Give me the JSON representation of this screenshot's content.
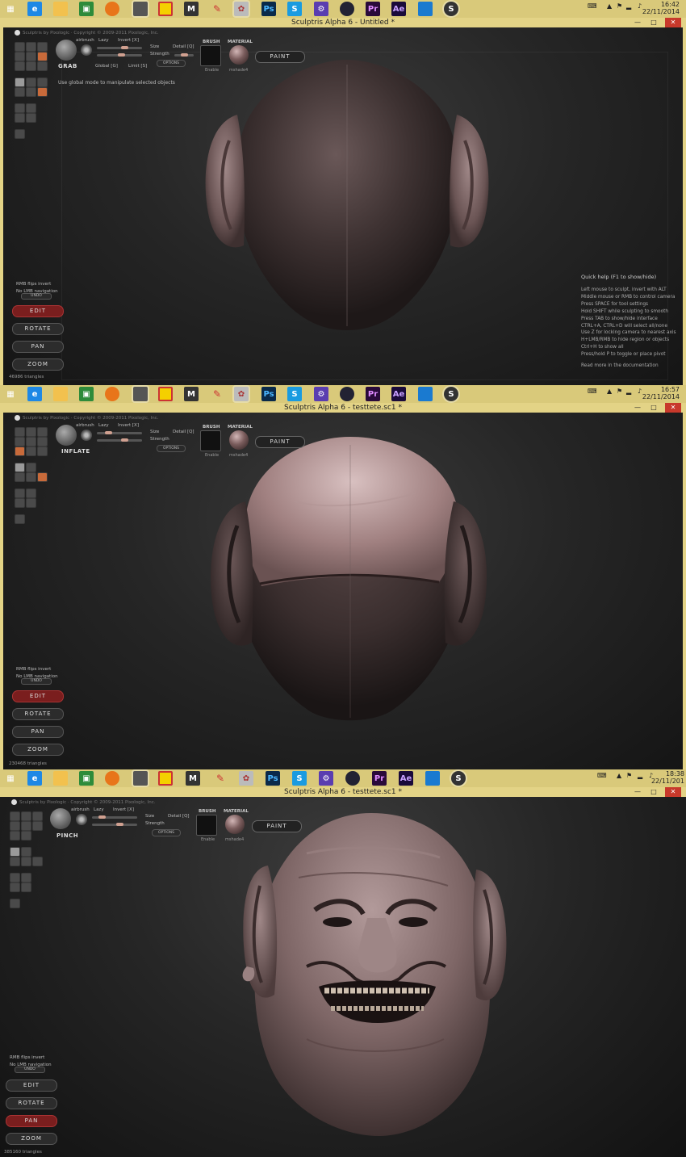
{
  "taskbar_icons": [
    "windows-start-icon",
    "ie-icon",
    "explorer-icon",
    "store-icon",
    "firefox-icon",
    "app-icon",
    "sticky-icon",
    "m-icon",
    "pencil-icon",
    "sculptris-doll-icon",
    "photoshop-icon",
    "skype-icon",
    "gear-icon",
    "camera-icon",
    "premiere-icon",
    "aftereffects-icon",
    "mail-icon",
    "sculptris-icon"
  ],
  "icon_labels": {
    "ps": "Ps",
    "pr": "Pr",
    "ae": "Ae",
    "m": "M",
    "s": "S"
  },
  "copyright": "Sculptris by Pixologic · Copyright © 2009-2011 Pixologic, Inc.",
  "labels": {
    "airbrush": "airbrush",
    "lazy": "Lazy",
    "invert": "Invert [X]",
    "size": "Size",
    "strength": "Strength",
    "detail": "Detail [Q]",
    "global": "Global [G]",
    "limit": "Limit [S]",
    "options": "OPTIONS",
    "brush": "BRUSH",
    "material": "MATERIAL",
    "enable": "Enable",
    "material_name": "mshade4",
    "paint": "PAINT",
    "rmb_flips": "RMB flips invert",
    "no_lmb": "No LMB navigation",
    "undo": "UNDO",
    "edit": "EDIT",
    "rotate": "ROTATE",
    "pan": "PAN",
    "zoom": "ZOOM"
  },
  "panels": [
    {
      "clock_time": "16:42",
      "clock_date": "22/11/2014",
      "window_title": "Sculptris Alpha 6 - Untitled *",
      "brush_name": "GRAB",
      "hint": "Use global mode to manipulate selected objects",
      "triangles": "46986 triangles",
      "active_nav": "EDIT"
    },
    {
      "clock_time": "16:57",
      "clock_date": "22/11/2014",
      "window_title": "Sculptris Alpha 6 - testtete.sc1 *",
      "brush_name": "INFLATE",
      "triangles": "230468 triangles",
      "active_nav": "EDIT"
    },
    {
      "clock_time": "18:38",
      "clock_date": "22/11/201",
      "window_title": "Sculptris Alpha 6 - testtete.sc1 *",
      "brush_name": "PINCH",
      "triangles": "385160 triangles",
      "active_nav": "PAN"
    }
  ],
  "quick_help": {
    "title": "Quick help (F1 to show/hide)",
    "lines": [
      "Left mouse to sculpt, invert with ALT",
      "Middle mouse or RMB to control camera",
      "Press SPACE for tool settings",
      "Hold SHIFT while sculpting to smooth",
      "Press TAB to show/hide interface",
      "CTRL+A, CTRL+D will select all/none",
      "Use Z for locking camera to nearest axis",
      "H+LMB/RMB to hide region or objects",
      "Ctrl+H to show all",
      "Press/hold P to toggle or place pivot"
    ],
    "more": "Read more in the documentation"
  }
}
